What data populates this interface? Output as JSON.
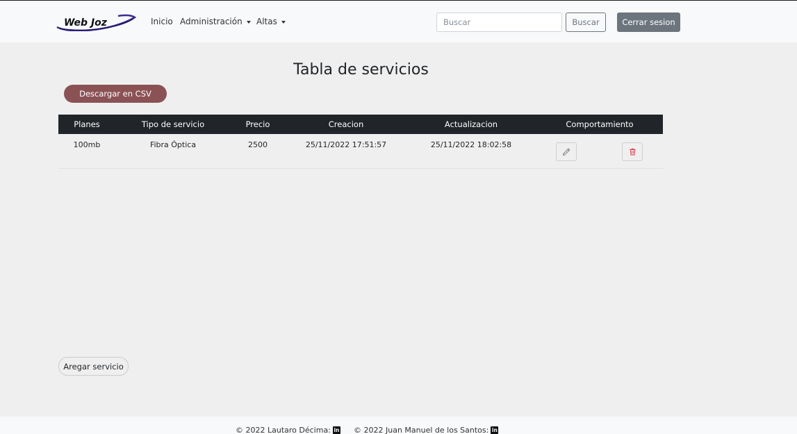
{
  "navbar": {
    "brand": "Web Joz",
    "links": [
      {
        "label": "Inicio",
        "dropdown": false
      },
      {
        "label": "Administración",
        "dropdown": true
      },
      {
        "label": "Altas",
        "dropdown": true
      }
    ],
    "search_placeholder": "Buscar",
    "search_button": "Buscar",
    "logout_button": "Cerrar sesion"
  },
  "page": {
    "title": "Tabla de servicios",
    "csv_button": "Descargar en CSV",
    "add_button": "Aregar servicio"
  },
  "table": {
    "headers": [
      "Planes",
      "Tipo de servicio",
      "Precio",
      "Creacion",
      "Actualizacion",
      "Comportamiento"
    ],
    "rows": [
      {
        "plan": "100mb",
        "tipo": "Fibra Óptica",
        "precio": "2500",
        "creacion": "25/11/2022 17:51:57",
        "actualizacion": "25/11/2022 18:02:58",
        "actions": [
          "pencil-icon",
          "trash-icon"
        ]
      }
    ]
  },
  "footer": {
    "credit1": "© 2022 Lautaro Décima:",
    "credit2": "© 2022 Juan Manuel de los Santos:",
    "icon": "linkedin-icon",
    "icon_text": "in"
  },
  "colors": {
    "navbar_bg": "#f8f9fa",
    "body_bg": "#efefef",
    "table_header_bg": "#212529",
    "csv_button_bg": "#8b5256",
    "logout_button_bg": "#6c757d",
    "delete_icon": "#dc3545"
  }
}
